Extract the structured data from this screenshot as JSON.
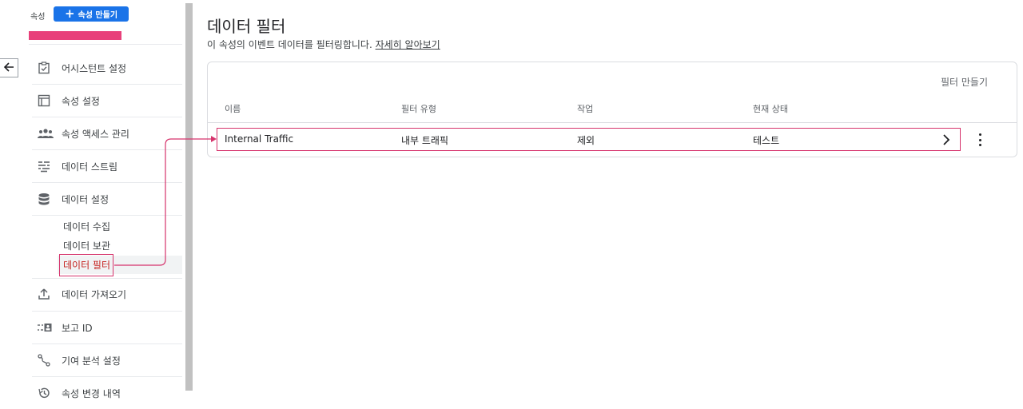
{
  "sidebar": {
    "property_label": "속성",
    "create_property_label": "속성 만들기",
    "items": [
      {
        "label": "어시스턴트 설정",
        "icon": "clipboard-check-icon"
      },
      {
        "label": "속성 설정",
        "icon": "settings-window-icon"
      },
      {
        "label": "속성 액세스 관리",
        "icon": "people-icon"
      },
      {
        "label": "데이터 스트림",
        "icon": "streams-icon"
      },
      {
        "label": "데이터 설정",
        "icon": "database-icon"
      }
    ],
    "sub_items": [
      {
        "label": "데이터 수집"
      },
      {
        "label": "데이터 보관"
      },
      {
        "label": "데이터 필터",
        "active": true
      }
    ],
    "lower_items": [
      {
        "label": "데이터 가져오기",
        "icon": "upload-icon"
      },
      {
        "label": "보고 ID",
        "icon": "report-id-icon"
      },
      {
        "label": "기여 분석 설정",
        "icon": "attribution-icon"
      },
      {
        "label": "속성 변경 내역",
        "icon": "history-icon"
      }
    ]
  },
  "main": {
    "title": "데이터 필터",
    "description": "이 속성의 이벤트 데이터를 필터링합니다.",
    "learn_more": "자세히 알아보기",
    "create_filter_label": "필터 만들기",
    "table": {
      "headers": [
        "이름",
        "필터 유형",
        "작업",
        "현재 상태"
      ],
      "rows": [
        {
          "name": "Internal Traffic",
          "type": "내부 트래픽",
          "action": "제외",
          "status": "테스트"
        }
      ]
    }
  },
  "colors": {
    "accent": "#1a73e8",
    "highlight": "#d6336c",
    "redaction": "#e8407a"
  }
}
